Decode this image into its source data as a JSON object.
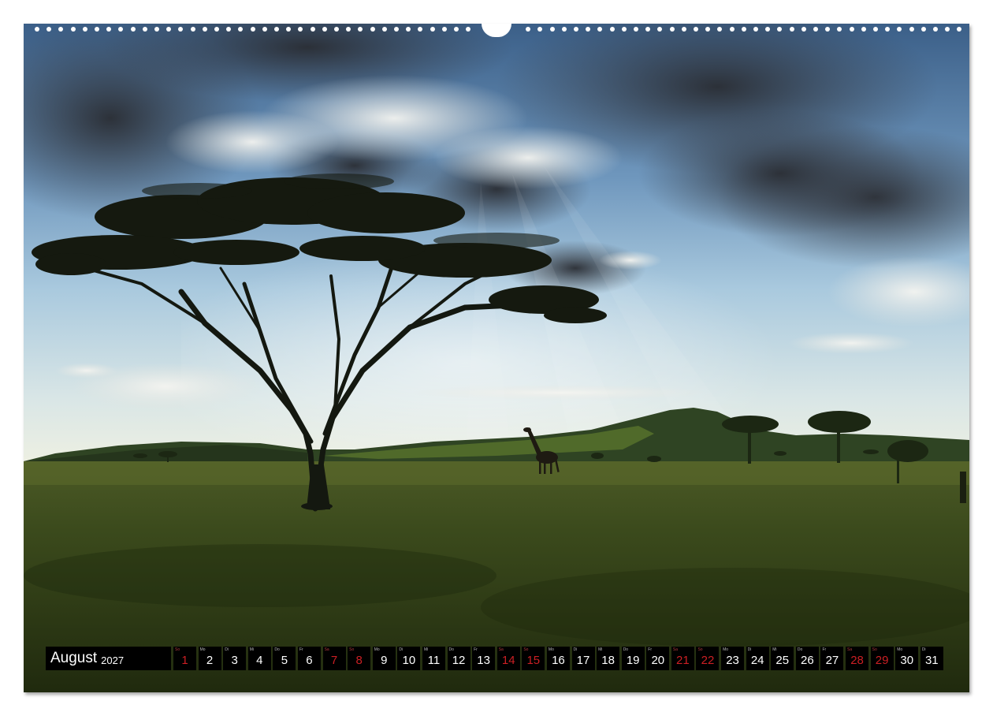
{
  "calendar": {
    "month": "August",
    "year": "2027",
    "days": [
      {
        "num": "1",
        "wd": "So",
        "holiday": true
      },
      {
        "num": "2",
        "wd": "Mo",
        "holiday": false
      },
      {
        "num": "3",
        "wd": "Di",
        "holiday": false
      },
      {
        "num": "4",
        "wd": "Mi",
        "holiday": false
      },
      {
        "num": "5",
        "wd": "Do",
        "holiday": false
      },
      {
        "num": "6",
        "wd": "Fr",
        "holiday": false
      },
      {
        "num": "7",
        "wd": "Sa",
        "holiday": true
      },
      {
        "num": "8",
        "wd": "So",
        "holiday": true
      },
      {
        "num": "9",
        "wd": "Mo",
        "holiday": false
      },
      {
        "num": "10",
        "wd": "Di",
        "holiday": false
      },
      {
        "num": "11",
        "wd": "Mi",
        "holiday": false
      },
      {
        "num": "12",
        "wd": "Do",
        "holiday": false
      },
      {
        "num": "13",
        "wd": "Fr",
        "holiday": false
      },
      {
        "num": "14",
        "wd": "Sa",
        "holiday": true
      },
      {
        "num": "15",
        "wd": "So",
        "holiday": true
      },
      {
        "num": "16",
        "wd": "Mo",
        "holiday": false
      },
      {
        "num": "17",
        "wd": "Di",
        "holiday": false
      },
      {
        "num": "18",
        "wd": "Mi",
        "holiday": false
      },
      {
        "num": "19",
        "wd": "Do",
        "holiday": false
      },
      {
        "num": "20",
        "wd": "Fr",
        "holiday": false
      },
      {
        "num": "21",
        "wd": "Sa",
        "holiday": true
      },
      {
        "num": "22",
        "wd": "So",
        "holiday": true
      },
      {
        "num": "23",
        "wd": "Mo",
        "holiday": false
      },
      {
        "num": "24",
        "wd": "Di",
        "holiday": false
      },
      {
        "num": "25",
        "wd": "Mi",
        "holiday": false
      },
      {
        "num": "26",
        "wd": "Do",
        "holiday": false
      },
      {
        "num": "27",
        "wd": "Fr",
        "holiday": false
      },
      {
        "num": "28",
        "wd": "Sa",
        "holiday": true
      },
      {
        "num": "29",
        "wd": "So",
        "holiday": true
      },
      {
        "num": "30",
        "wd": "Mo",
        "holiday": false
      },
      {
        "num": "31",
        "wd": "Di",
        "holiday": false
      }
    ]
  },
  "colors": {
    "weekend_red": "#cc1f24",
    "strip_bg": "#000000"
  },
  "photo": {
    "subject": "acacia tree and giraffe on savanna under cloudy sky"
  }
}
